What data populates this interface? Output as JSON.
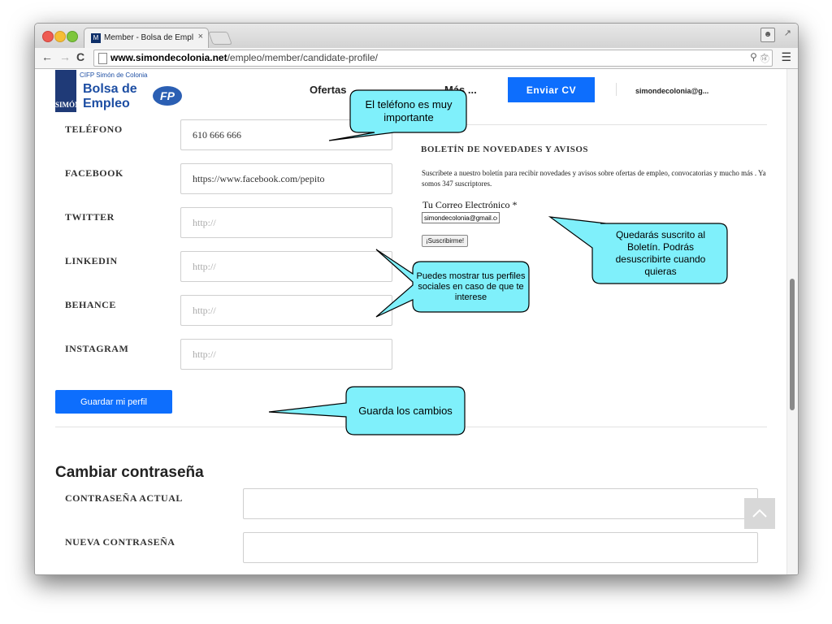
{
  "browser": {
    "tab_title": "Member - Bolsa de Empleo",
    "tab_close": "×",
    "favicon": "M",
    "url_domain": "www.simondecolonia.net",
    "url_path": "/empleo/member/candidate-profile/",
    "icons": [
      "back-icon",
      "forward-icon",
      "reload-icon",
      "page-icon",
      "key-icon",
      "star-icon",
      "info-icon",
      "menu-icon",
      "profile-icon",
      "fullscreen-icon"
    ]
  },
  "header": {
    "logo_small": "CIFP Simón de Colonia",
    "logo_line1": "Bolsa de",
    "logo_line2": "Empleo",
    "logo_fp": "FP",
    "logo_simon": "SIMÓN",
    "nav_ofertas": "Ofertas",
    "nav_mas": "Más ...",
    "enviar_cv": "Enviar CV",
    "user": "simondecolonia@g..."
  },
  "profile": {
    "telefono_label": "TELÉFONO",
    "telefono_value": "610 666 666",
    "facebook_label": "FACEBOOK",
    "facebook_value": "https://www.facebook.com/pepito",
    "twitter_label": "TWITTER",
    "twitter_placeholder": "http://",
    "linkedin_label": "LINKEDIN",
    "linkedin_placeholder": "http://",
    "behance_label": "BEHANCE",
    "behance_placeholder": "http://",
    "instagram_label": "INSTAGRAM",
    "instagram_placeholder": "http://",
    "save_label": "Guardar mi perfil"
  },
  "newsletter": {
    "title": "BOLETÍN DE NOVEDADES Y AVISOS",
    "description": "Suscríbete a nuestro boletín para recibir novedades y avisos sobre ofertas de empleo, convocatorias y mucho más . Ya somos 347 suscriptores.",
    "email_label": "Tu Correo Electrónico *",
    "email_value": "simondecolonia@gmail.com",
    "subscribe_label": "¡Suscribirme!"
  },
  "password": {
    "title": "Cambiar contraseña",
    "current_label": "CONTRASEÑA ACTUAL",
    "new_label": "NUEVA CONTRASEÑA"
  },
  "callouts": {
    "telefono": "El teléfono es muy importante",
    "social": "Puedes mostrar tus perfiles sociales en caso de que te interese",
    "boletin": "Quedarás suscrito al Boletín. Podrás desuscribirte cuando quieras",
    "guardar": "Guarda los cambios"
  },
  "colors": {
    "primary_button": "#0d6efd",
    "callout_fill": "#7ff0fb",
    "logo_blue": "#1d4ea3"
  }
}
